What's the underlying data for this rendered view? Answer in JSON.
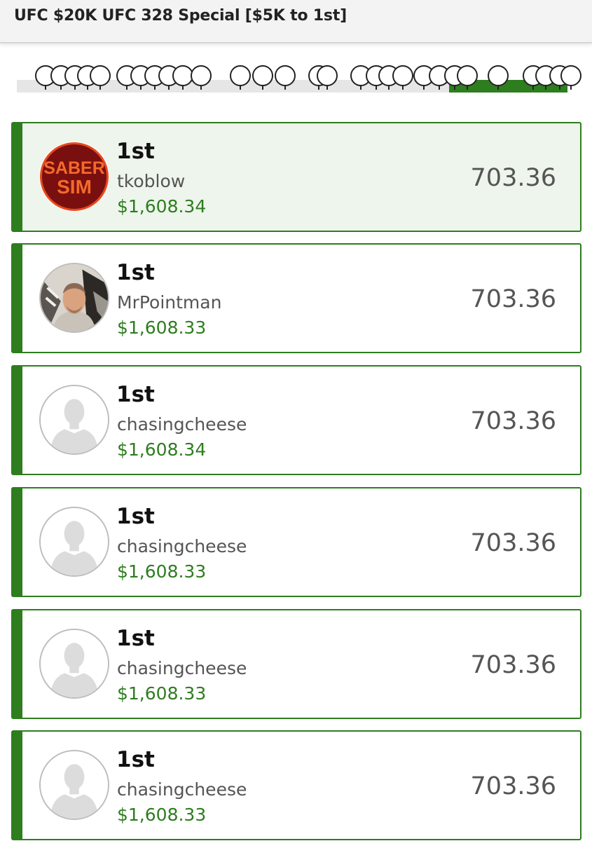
{
  "header": {
    "title": "UFC $20K UFC 328 Special [$5K to 1st]"
  },
  "colors": {
    "accent": "#2e7d1f",
    "highlight_bg": "#eef5ec"
  },
  "progress": {
    "filled_fraction": 0.215,
    "marker_icon": "balloon-marker-icon"
  },
  "entries": [
    {
      "rank": "1st",
      "username": "tkoblow",
      "winnings": "$1,608.34",
      "score": "703.36",
      "avatar": "sabersim-logo",
      "avatar_text_line1": "SABER",
      "avatar_text_line2": "SIM",
      "highlighted": true
    },
    {
      "rank": "1st",
      "username": "MrPointman",
      "winnings": "$1,608.33",
      "score": "703.36",
      "avatar": "user-photo",
      "highlighted": false
    },
    {
      "rank": "1st",
      "username": "chasingcheese",
      "winnings": "$1,608.34",
      "score": "703.36",
      "avatar": "default-avatar-icon",
      "highlighted": false
    },
    {
      "rank": "1st",
      "username": "chasingcheese",
      "winnings": "$1,608.33",
      "score": "703.36",
      "avatar": "default-avatar-icon",
      "highlighted": false
    },
    {
      "rank": "1st",
      "username": "chasingcheese",
      "winnings": "$1,608.33",
      "score": "703.36",
      "avatar": "default-avatar-icon",
      "highlighted": false
    },
    {
      "rank": "1st",
      "username": "chasingcheese",
      "winnings": "$1,608.33",
      "score": "703.36",
      "avatar": "default-avatar-icon",
      "highlighted": false
    }
  ]
}
